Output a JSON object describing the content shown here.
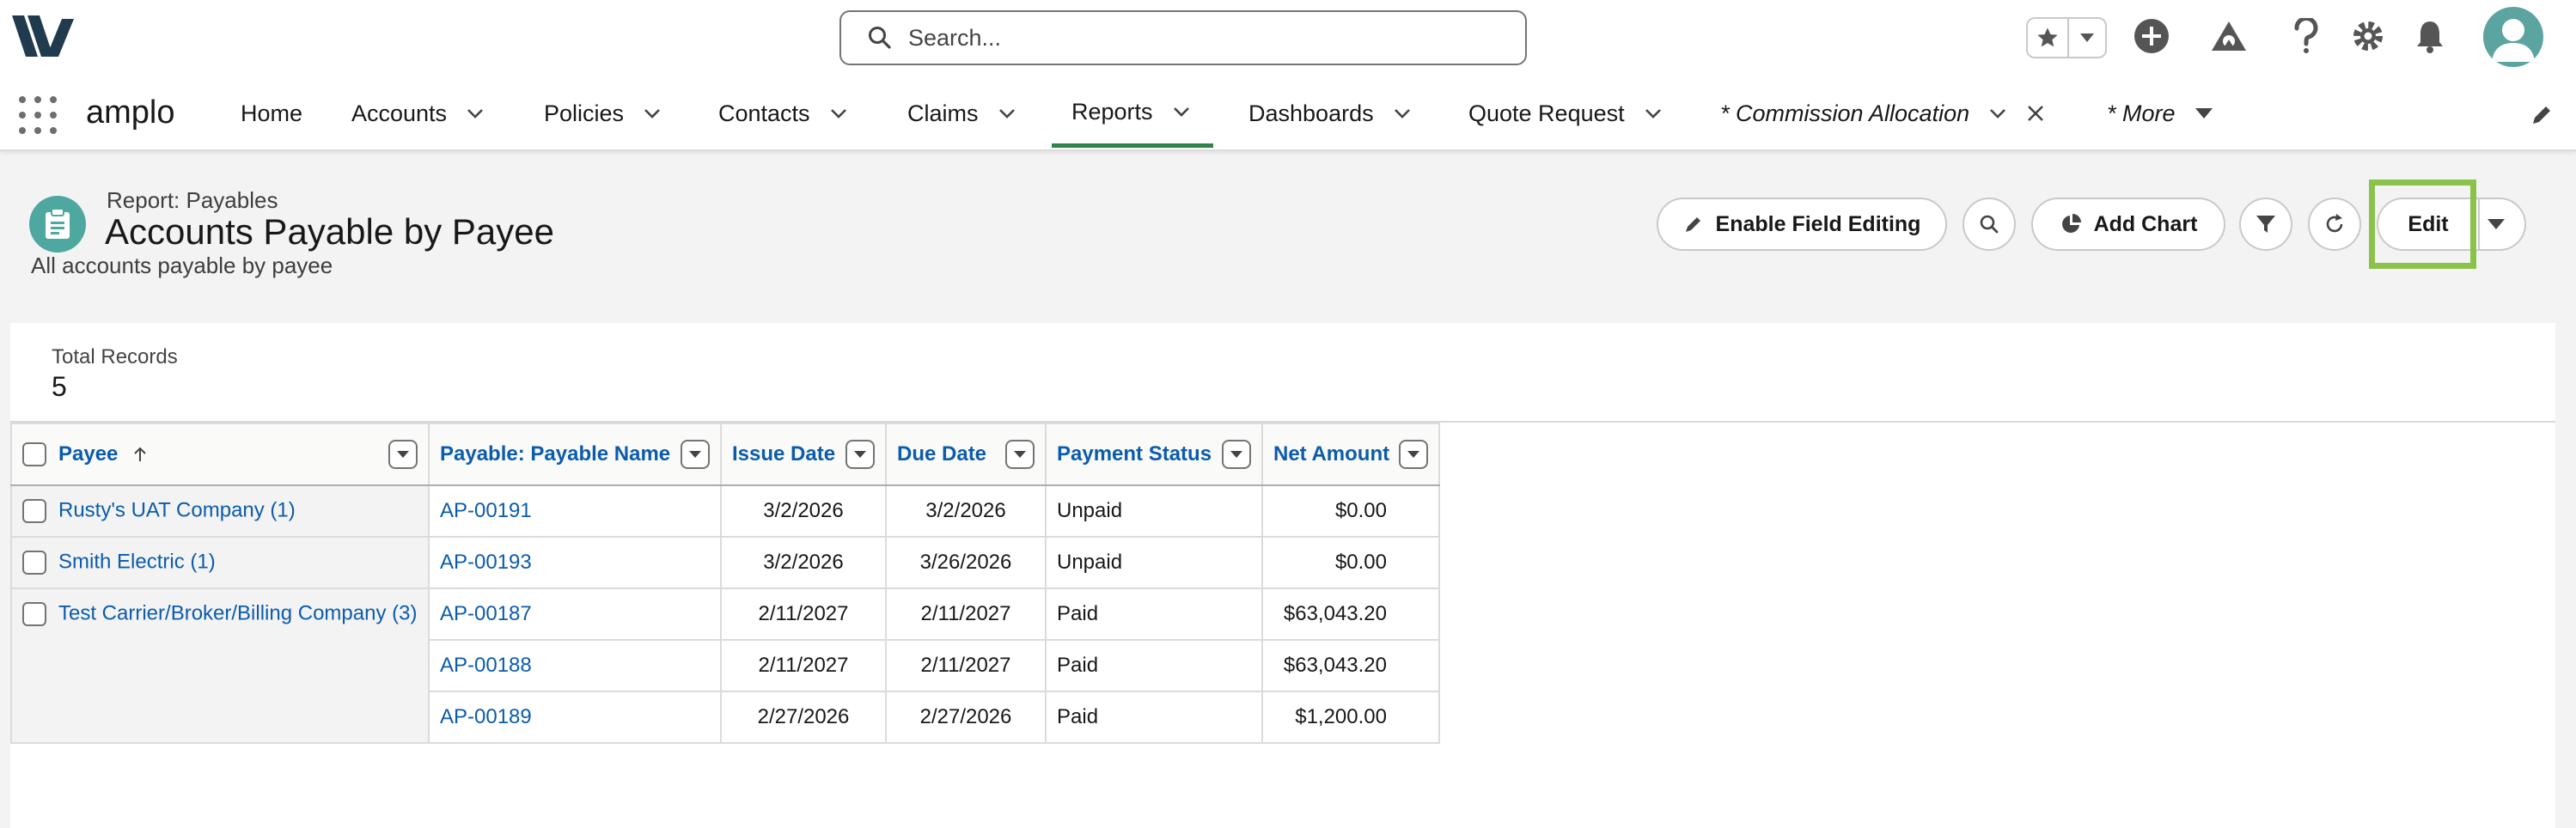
{
  "header": {
    "search_placeholder": "Search...",
    "icons": [
      "star-icon",
      "chevron-down-icon",
      "add-icon",
      "trailhead-icon",
      "help-icon",
      "setup-gear-icon",
      "bell-icon",
      "avatar-icon"
    ]
  },
  "nav": {
    "app_name": "amplo",
    "items": [
      {
        "label": "Home"
      },
      {
        "label": "Accounts"
      },
      {
        "label": "Policies"
      },
      {
        "label": "Contacts"
      },
      {
        "label": "Claims"
      },
      {
        "label": "Reports"
      },
      {
        "label": "Dashboards"
      },
      {
        "label": "Quote Request"
      },
      {
        "label": "* Commission Allocation"
      },
      {
        "label": "* More"
      }
    ],
    "active": "Reports"
  },
  "report": {
    "type": "Report: Payables",
    "title": "Accounts Payable by Payee",
    "description": "All accounts payable by payee",
    "buttons": {
      "enable_field_editing": "Enable Field Editing",
      "add_chart": "Add Chart",
      "edit": "Edit"
    },
    "total_label": "Total Records",
    "total_value": "5",
    "columns": [
      "Payee",
      "Payable: Payable Name",
      "Issue Date",
      "Due Date",
      "Payment Status",
      "Net Amount"
    ],
    "groups": [
      {
        "payee": "Rusty's UAT Company (1)",
        "rows": [
          {
            "name": "AP-00191",
            "issue": "3/2/2026",
            "due": "3/2/2026",
            "status": "Unpaid",
            "amount": "$0.00"
          }
        ]
      },
      {
        "payee": "Smith Electric (1)",
        "rows": [
          {
            "name": "AP-00193",
            "issue": "3/2/2026",
            "due": "3/26/2026",
            "status": "Unpaid",
            "amount": "$0.00"
          }
        ]
      },
      {
        "payee": "Test Carrier/Broker/Billing Company (3)",
        "rows": [
          {
            "name": "AP-00187",
            "issue": "2/11/2027",
            "due": "2/11/2027",
            "status": "Paid",
            "amount": "$63,043.20"
          },
          {
            "name": "AP-00188",
            "issue": "2/11/2027",
            "due": "2/11/2027",
            "status": "Paid",
            "amount": "$63,043.20"
          },
          {
            "name": "AP-00189",
            "issue": "2/27/2026",
            "due": "2/27/2026",
            "status": "Paid",
            "amount": "$1,200.00"
          }
        ]
      }
    ]
  },
  "colors": {
    "active_tab": "#2e844a",
    "link": "#0b5cab",
    "report_icon": "#4ea89f",
    "highlight": "#8bc34a"
  }
}
